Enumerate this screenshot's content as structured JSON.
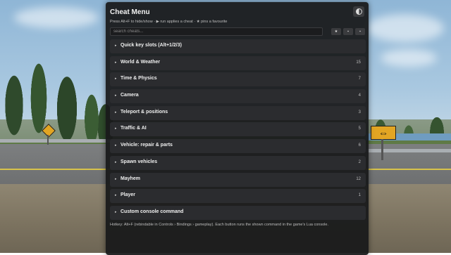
{
  "app": {
    "title": "Cheat Menu",
    "hint": "Press Alt+F to hide/show · ▶ run applies a cheat · ★ pins a favourite",
    "footer": "Hotkey: Alt+F (rebindable in Controls › Bindings › gameplay). Each button runs the shown command in the game's Lua console."
  },
  "theme_toggle": {
    "icon": "half-circle-icon"
  },
  "search": {
    "placeholder": "search cheats..."
  },
  "toolbar": [
    {
      "label": "★",
      "icon": "star-icon"
    },
    {
      "label": "▪",
      "icon": "square-icon"
    },
    {
      "label": "▪",
      "icon": "square-icon"
    }
  ],
  "categories": [
    {
      "label": "Quick key slots (Alt+1/2/3)",
      "count": ""
    },
    {
      "label": "World & Weather",
      "count": "15"
    },
    {
      "label": "Time & Physics",
      "count": "7"
    },
    {
      "label": "Camera",
      "count": "4"
    },
    {
      "label": "Teleport & positions",
      "count": "3"
    },
    {
      "label": "Traffic & AI",
      "count": "5"
    },
    {
      "label": "Vehicle: repair & parts",
      "count": "6"
    },
    {
      "label": "Spawn vehicles",
      "count": "2"
    },
    {
      "label": "Mayhem",
      "count": "12"
    },
    {
      "label": "Player",
      "count": "1"
    },
    {
      "label": "Custom console command",
      "count": ""
    }
  ],
  "colors": {
    "panel_bg": "#18191b",
    "row_bg": "#2b2c2f",
    "text": "#f0f0f0",
    "muted": "#bdbdbd"
  }
}
